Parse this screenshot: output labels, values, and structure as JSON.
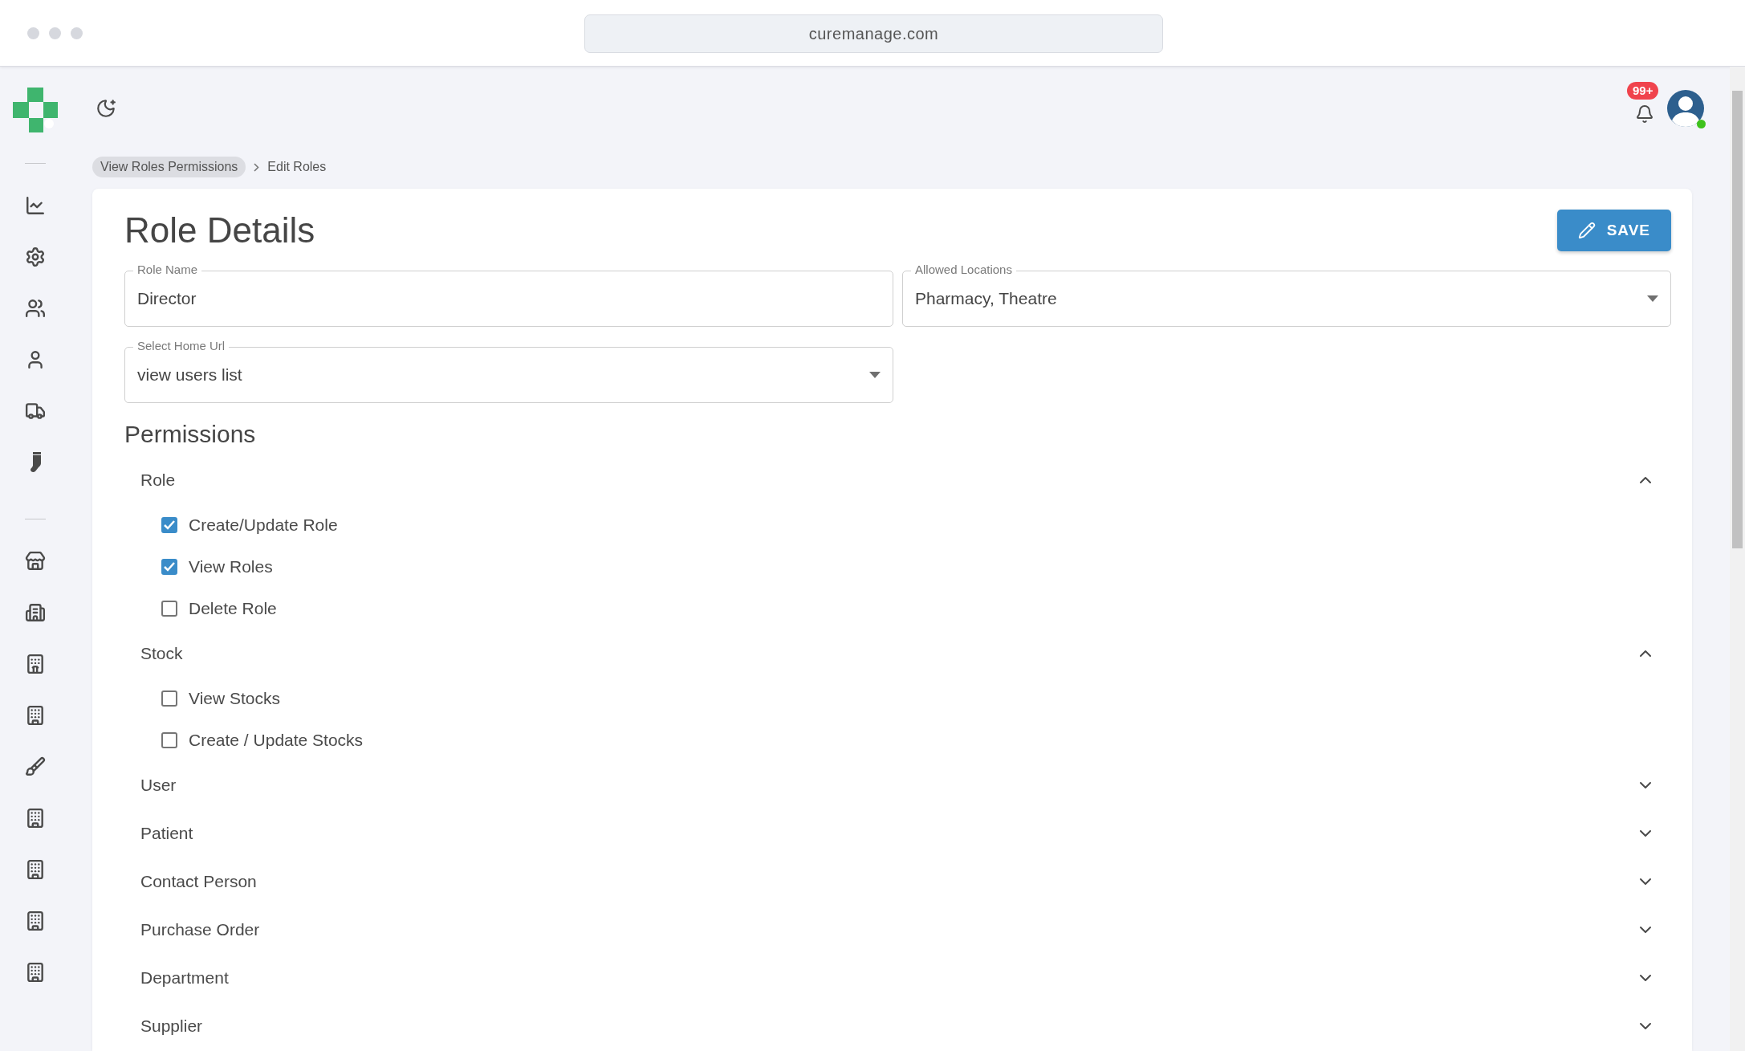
{
  "browser": {
    "address": "curemanage.com"
  },
  "notifications": {
    "count": "99+"
  },
  "user": {
    "online": true
  },
  "breadcrumb": [
    {
      "label": "View Roles Permissions",
      "kind": "link"
    },
    {
      "label": "Edit Roles",
      "kind": "current"
    }
  ],
  "page": {
    "title": "Role Details",
    "save_label": "SAVE"
  },
  "fields": [
    {
      "label": "Role Name",
      "value": "Director",
      "kind": "text"
    },
    {
      "label": "Allowed Locations",
      "value": "Pharmacy, Theatre",
      "kind": "select"
    },
    {
      "label": "Select Home Url",
      "value": "view users list",
      "kind": "select"
    }
  ],
  "permissions": {
    "title": "Permissions",
    "groups": [
      {
        "name": "Role",
        "expanded": true,
        "items": [
          {
            "label": "Create/Update Role",
            "checked": true
          },
          {
            "label": "View Roles",
            "checked": true
          },
          {
            "label": "Delete Role",
            "checked": false
          }
        ]
      },
      {
        "name": "Stock",
        "expanded": true,
        "items": [
          {
            "label": "View Stocks",
            "checked": false
          },
          {
            "label": "Create / Update Stocks",
            "checked": false
          }
        ]
      },
      {
        "name": "User",
        "expanded": false
      },
      {
        "name": "Patient",
        "expanded": false
      },
      {
        "name": "Contact Person",
        "expanded": false
      },
      {
        "name": "Purchase Order",
        "expanded": false
      },
      {
        "name": "Department",
        "expanded": false
      },
      {
        "name": "Supplier",
        "expanded": false
      }
    ]
  }
}
